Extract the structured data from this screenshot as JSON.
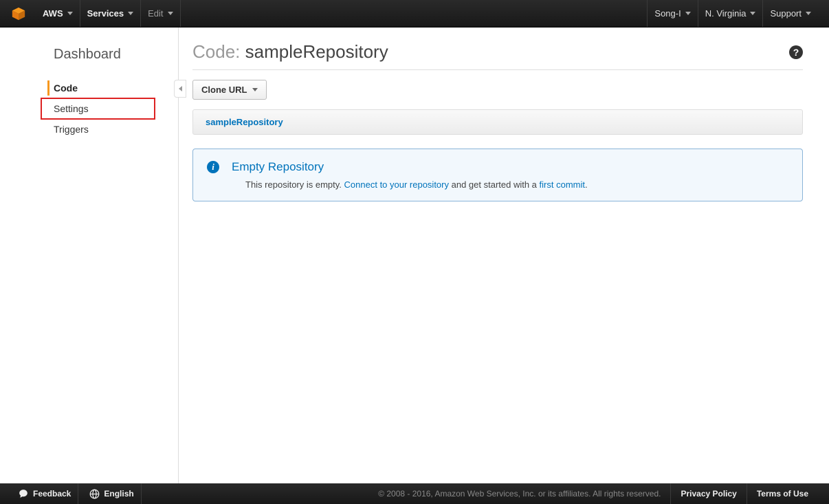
{
  "topbar": {
    "aws": "AWS",
    "services": "Services",
    "edit": "Edit",
    "user": "Song-I",
    "region": "N. Virginia",
    "support": "Support"
  },
  "sidebar": {
    "title": "Dashboard",
    "items": [
      {
        "label": "Code",
        "active": true
      },
      {
        "label": "Settings",
        "highlighted": true
      },
      {
        "label": "Triggers"
      }
    ]
  },
  "page": {
    "title_prefix": "Code:",
    "repo_name": "sampleRepository",
    "clone_url_label": "Clone URL",
    "breadcrumb": "sampleRepository"
  },
  "info": {
    "heading": "Empty Repository",
    "text1": "This repository is empty. ",
    "link1": "Connect to your repository",
    "text2": " and get started with a ",
    "link2": "first commit",
    "text3": "."
  },
  "footer": {
    "feedback": "Feedback",
    "language": "English",
    "copyright": "© 2008 - 2016, Amazon Web Services, Inc. or its affiliates. All rights reserved.",
    "privacy": "Privacy Policy",
    "terms": "Terms of Use"
  }
}
